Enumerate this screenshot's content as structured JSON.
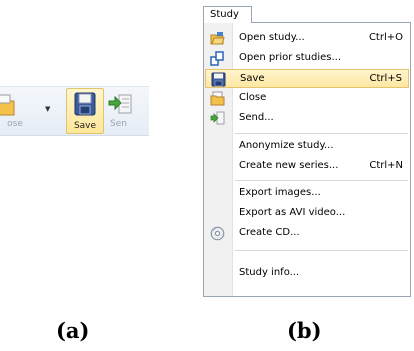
{
  "toolbar": {
    "close_label": "ose",
    "save_label": "Save",
    "send_label": "Sen"
  },
  "menu": {
    "title": "Study",
    "items": [
      {
        "label": "Open study...",
        "shortcut": "Ctrl+O",
        "icon": "folder-open-icon"
      },
      {
        "label": "Open prior studies...",
        "shortcut": "",
        "icon": "prior-studies-icon"
      },
      {
        "label": "Save",
        "shortcut": "Ctrl+S",
        "icon": "floppy-disk-icon",
        "highlighted": true
      },
      {
        "label": "Close",
        "shortcut": "",
        "icon": "folder-close-icon"
      },
      {
        "label": "Send...",
        "shortcut": "",
        "icon": "send-icon"
      },
      {
        "label": "Anonymize study...",
        "shortcut": "",
        "icon": ""
      },
      {
        "label": "Create new series...",
        "shortcut": "Ctrl+N",
        "icon": ""
      },
      {
        "label": "Export images...",
        "shortcut": "",
        "icon": ""
      },
      {
        "label": "Export as AVI video...",
        "shortcut": "",
        "icon": ""
      },
      {
        "label": "Create CD...",
        "shortcut": "",
        "icon": "cd-icon"
      },
      {
        "label": "Study info...",
        "shortcut": "",
        "icon": ""
      }
    ]
  },
  "captions": {
    "a": "(a)",
    "b": "(b)"
  },
  "colors": {
    "highlight_top": "#fff4cc",
    "highlight_bottom": "#fde7a2",
    "highlight_border": "#e4c46f",
    "menu_border": "#9aa6b3"
  }
}
